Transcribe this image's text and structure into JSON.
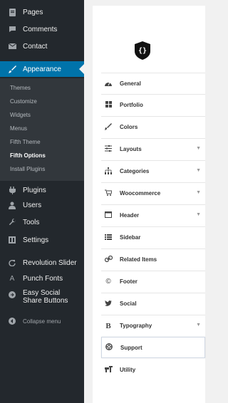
{
  "sidebar": {
    "top_items": [
      {
        "label": "Pages",
        "icon": "pages-icon"
      },
      {
        "label": "Comments",
        "icon": "comments-icon"
      },
      {
        "label": "Contact",
        "icon": "mail-icon"
      }
    ],
    "active_item": {
      "label": "Appearance",
      "icon": "brush-icon"
    },
    "submenu": [
      "Themes",
      "Customize",
      "Widgets",
      "Menus",
      "Fifth Theme",
      "Fifth Options",
      "Install Plugins"
    ],
    "submenu_current": "Fifth Options",
    "bottom_items": [
      {
        "label": "Plugins",
        "icon": "plugins-icon"
      },
      {
        "label": "Users",
        "icon": "users-icon"
      },
      {
        "label": "Tools",
        "icon": "tools-icon"
      },
      {
        "label": "Settings",
        "icon": "settings-icon"
      },
      {
        "label": "Revolution Slider",
        "icon": "refresh-icon"
      },
      {
        "label": "Punch Fonts",
        "icon": "font-icon"
      },
      {
        "label": "Easy Social Share Buttons",
        "icon": "share-icon"
      },
      {
        "label": "Collapse menu",
        "icon": "collapse-icon"
      }
    ],
    "colors": {
      "bg": "#23282d",
      "active": "#0073aa",
      "submenu_bg": "#32373c"
    }
  },
  "options_panel": {
    "logo": "shield-braces-logo",
    "items": [
      {
        "label": "General",
        "icon": "tachometer-icon",
        "has_children": false
      },
      {
        "label": "Portfolio",
        "icon": "grid-icon",
        "has_children": false
      },
      {
        "label": "Colors",
        "icon": "brush-icon",
        "has_children": false
      },
      {
        "label": "Layouts",
        "icon": "sliders-icon",
        "has_children": true
      },
      {
        "label": "Categories",
        "icon": "sitemap-icon",
        "has_children": true
      },
      {
        "label": "Woocommerce",
        "icon": "cart-icon",
        "has_children": true
      },
      {
        "label": "Header",
        "icon": "window-icon",
        "has_children": true
      },
      {
        "label": "Sidebar",
        "icon": "list-icon",
        "has_children": false
      },
      {
        "label": "Related Items",
        "icon": "link-icon",
        "has_children": false
      },
      {
        "label": "Footer",
        "icon": "copyright-icon",
        "has_children": false
      },
      {
        "label": "Social",
        "icon": "twitter-icon",
        "has_children": false
      },
      {
        "label": "Typography",
        "icon": "font-b-icon",
        "has_children": true
      },
      {
        "label": "Support",
        "icon": "lifebuoy-icon",
        "has_children": false
      },
      {
        "label": "Utility",
        "icon": "tools-icon",
        "has_children": false
      }
    ],
    "selected": "Support"
  }
}
